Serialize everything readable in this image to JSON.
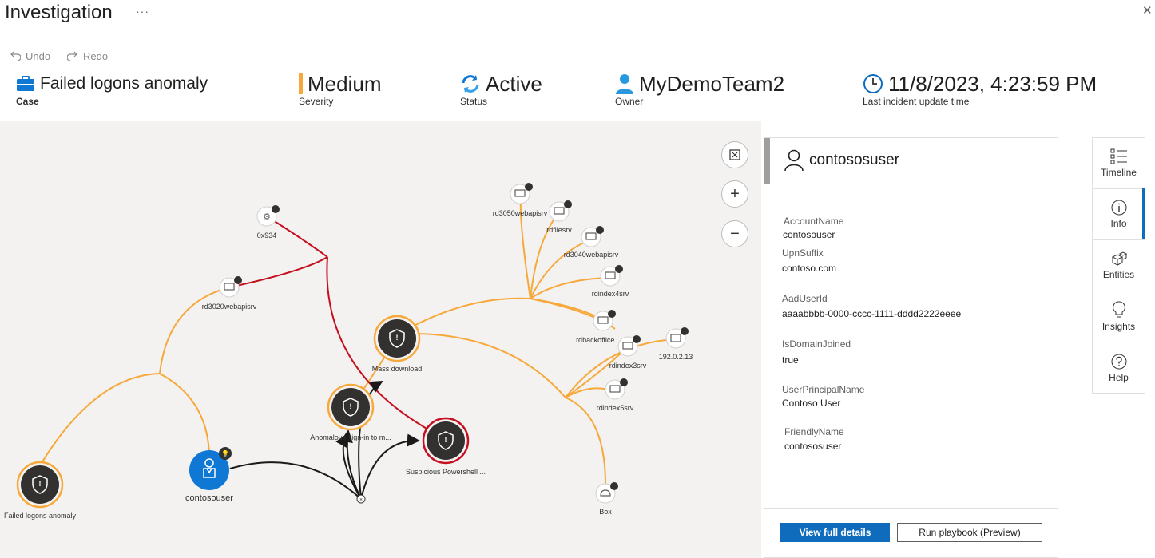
{
  "header": {
    "title": "Investigation",
    "more": "···",
    "close": "✕",
    "undo": "Undo",
    "redo": "Redo"
  },
  "summary": {
    "case": {
      "value": "Failed logons anomaly",
      "caption": "Case"
    },
    "severity": {
      "value": "Medium",
      "caption": "Severity",
      "color": "#f7a83a"
    },
    "status": {
      "value": "Active",
      "caption": "Status"
    },
    "owner": {
      "value": "MyDemoTeam2",
      "caption": "Owner"
    },
    "updated": {
      "value": "11/8/2023, 4:23:59 PM",
      "caption": "Last incident update time"
    }
  },
  "graph": {
    "nodes": {
      "failed_logons": "Failed logons anomaly",
      "contosouser": "contosouser",
      "anomalous_signin": "Anomalous sign-in to m...",
      "mass_download": "Mass download",
      "suspicious_ps": "Suspicious Powershell ...",
      "n0x934": "0x934",
      "rd3020": "rd3020webapisrv",
      "rd3050": "rd3050webapisrv",
      "rdfiles": "rdfilesrv",
      "rd3040": "rd3040webapisrv",
      "rdindex4": "rdindex4srv",
      "rdbackoffice": "rdbackoffice...",
      "rdindex3": "rdindex3srv",
      "ip": "192.0.2.13",
      "rdindex5": "rdindex5srv",
      "box": "Box"
    },
    "colors": {
      "orange": "#f7a83a",
      "red": "#c50f1f",
      "dark": "#323130",
      "blue": "#0f78d4"
    }
  },
  "panel": {
    "entity_name": "contososuser",
    "properties": [
      {
        "key": "AccountName",
        "value": "contosouser"
      },
      {
        "key": "UpnSuffix",
        "value": "contoso.com"
      },
      {
        "key": "AadUserId",
        "value": "aaaabbbb-0000-cccc-1111-dddd2222eeee"
      },
      {
        "key": "IsDomainJoined",
        "value": "true"
      },
      {
        "key": "UserPrincipalName",
        "value": "Contoso User"
      },
      {
        "key": "FriendlyName",
        "value": "contososuser"
      }
    ],
    "view_details": "View full details",
    "run_playbook": "Run playbook (Preview)"
  },
  "rail": [
    {
      "label": "Timeline",
      "icon": "timeline-icon"
    },
    {
      "label": "Info",
      "icon": "info-icon"
    },
    {
      "label": "Entities",
      "icon": "entities-icon"
    },
    {
      "label": "Insights",
      "icon": "lightbulb-icon"
    },
    {
      "label": "Help",
      "icon": "help-icon"
    }
  ]
}
